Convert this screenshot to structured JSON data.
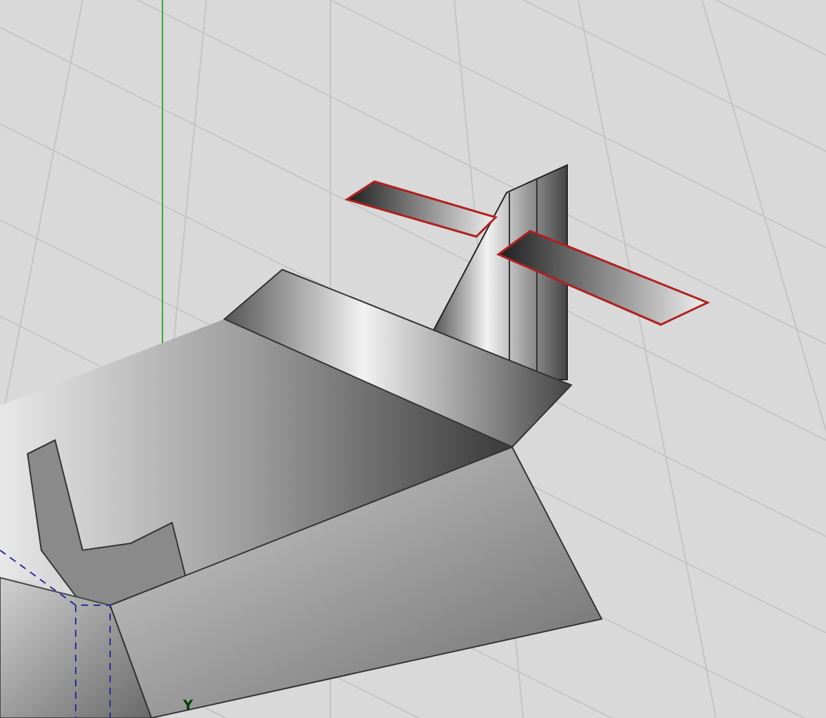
{
  "viewport": {
    "axis_label": "Y"
  }
}
